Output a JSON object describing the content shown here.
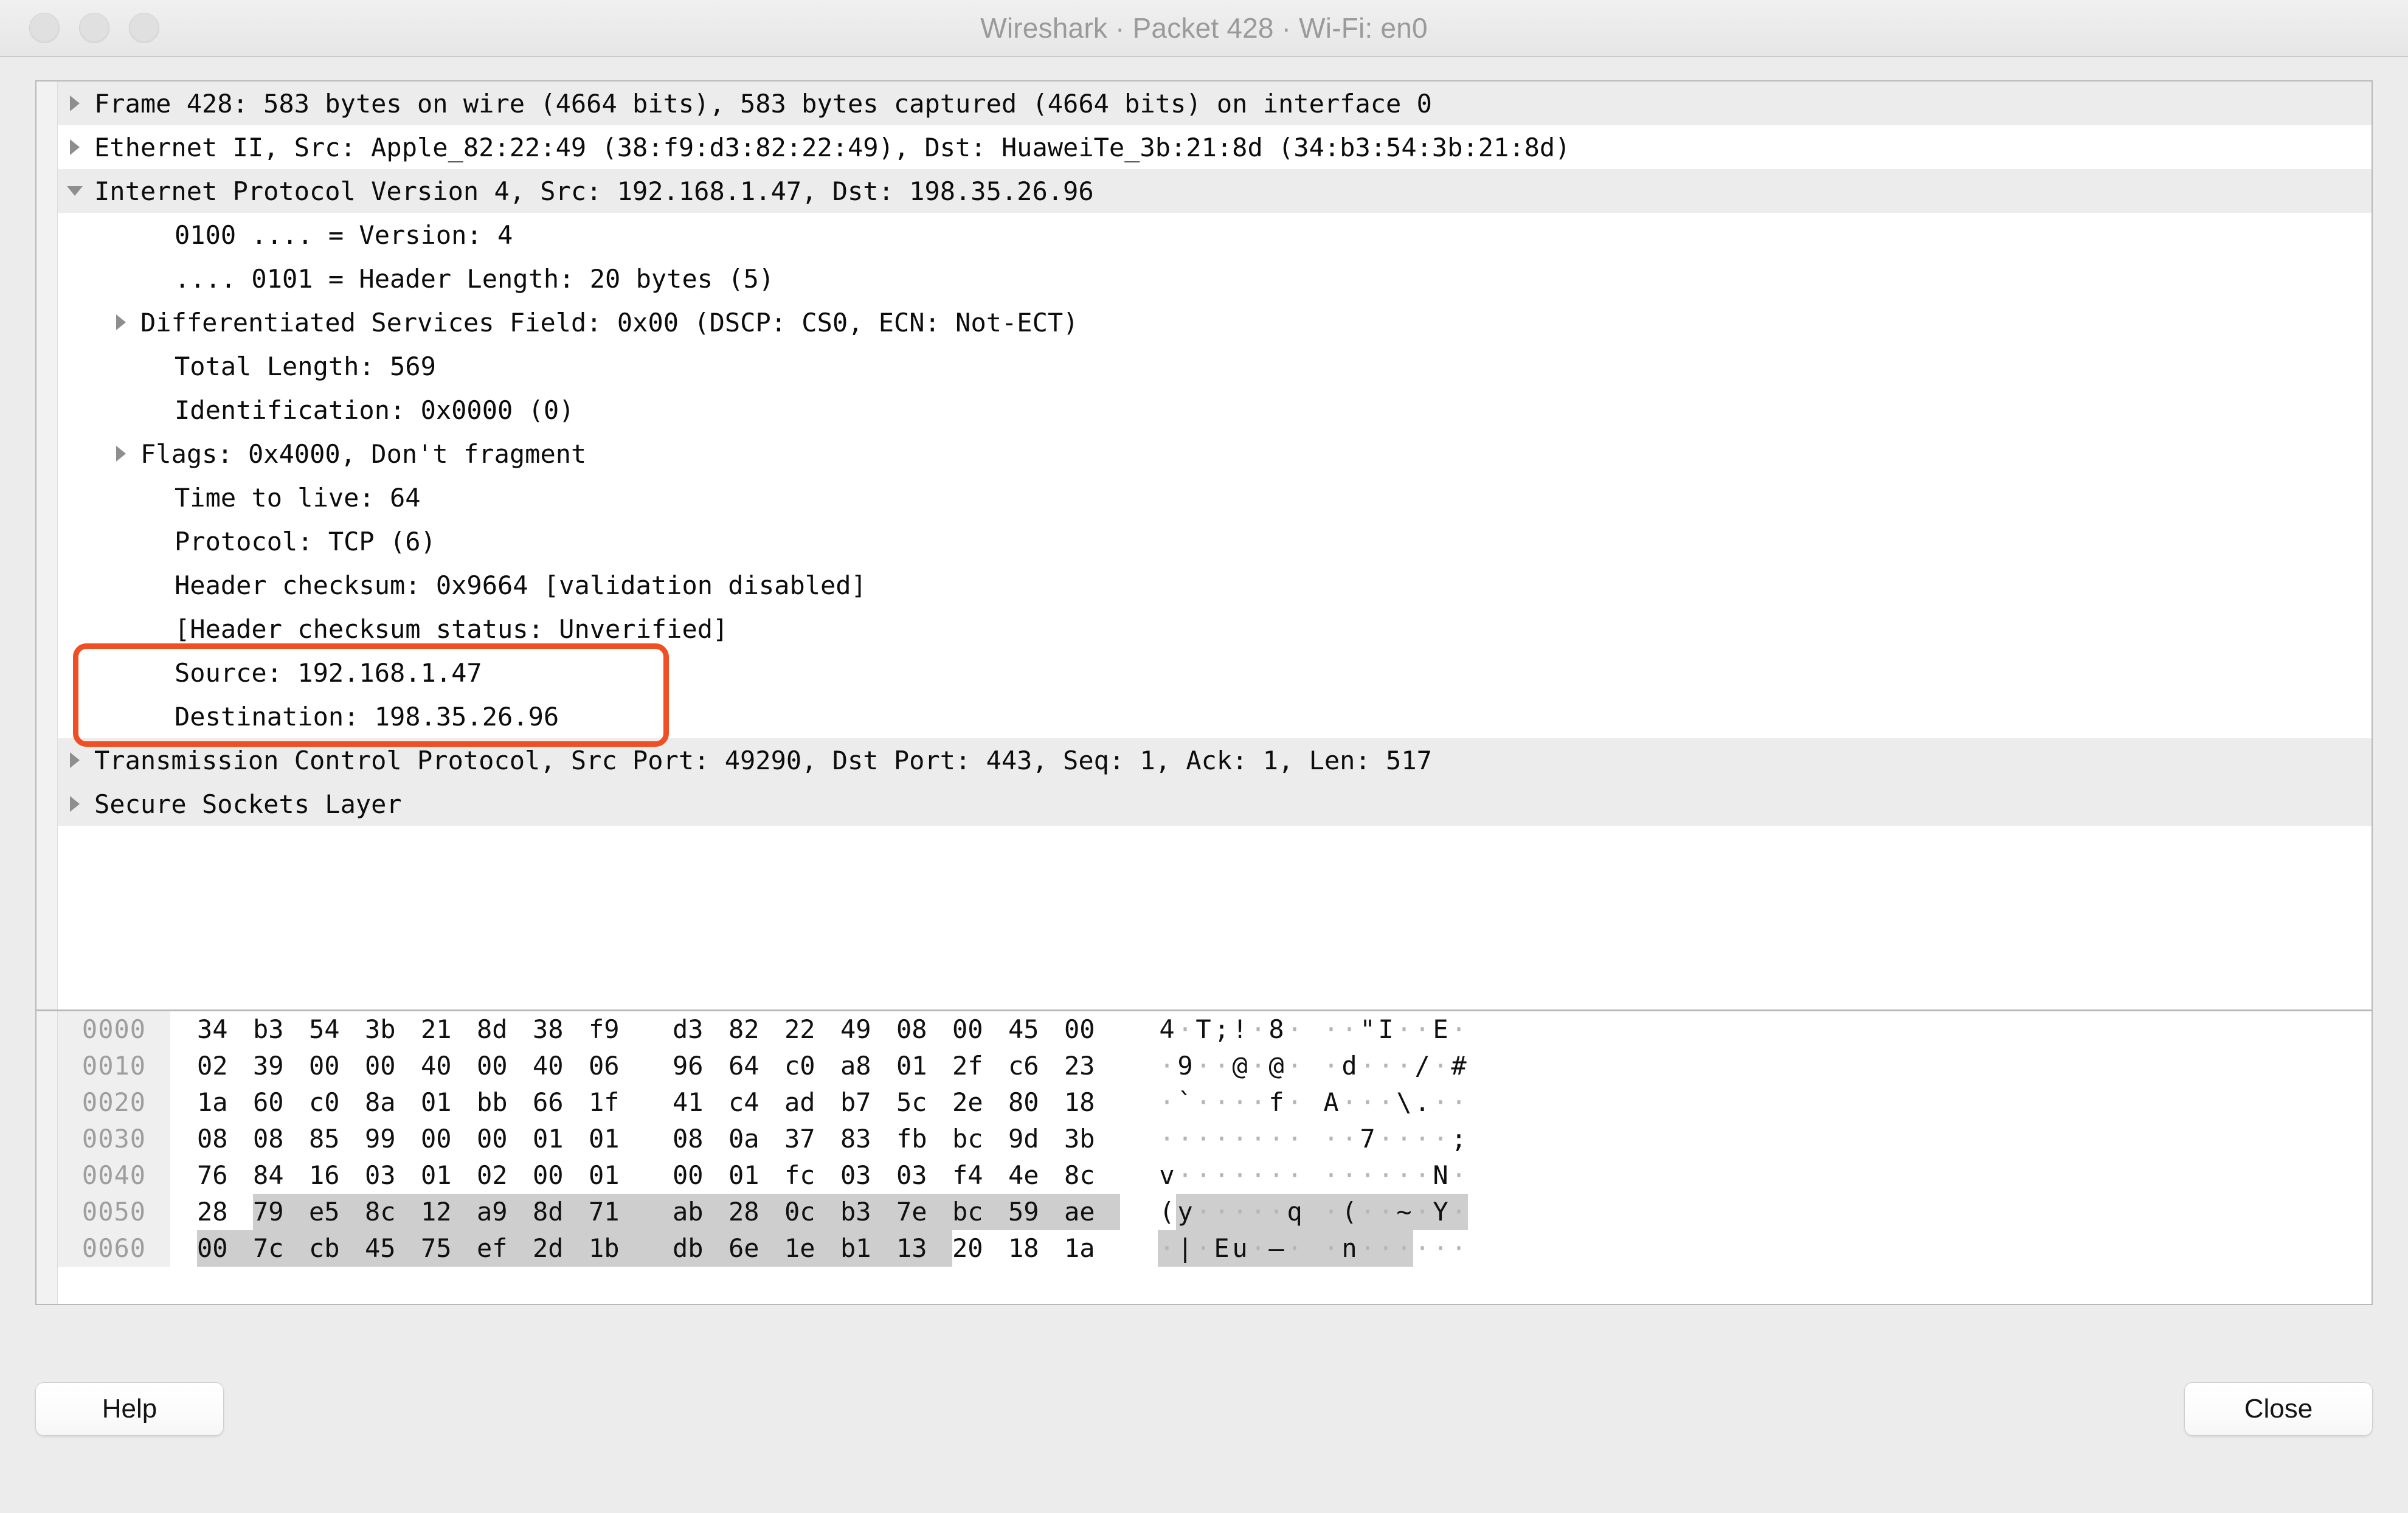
{
  "window": {
    "title": "Wireshark · Packet 428 · Wi-Fi: en0",
    "traffic_lights": [
      "close",
      "minimize",
      "zoom"
    ]
  },
  "accent_color": "#f04e23",
  "detail_tree": [
    {
      "depth": 0,
      "twisty": "collapsed",
      "shaded": true,
      "text": "Frame 428: 583 bytes on wire (4664 bits), 583 bytes captured (4664 bits) on interface 0"
    },
    {
      "depth": 0,
      "twisty": "collapsed",
      "shaded": false,
      "text": "Ethernet II, Src: Apple_82:22:49 (38:f9:d3:82:22:49), Dst: HuaweiTe_3b:21:8d (34:b3:54:3b:21:8d)"
    },
    {
      "depth": 0,
      "twisty": "expanded",
      "shaded": true,
      "text": "Internet Protocol Version 4, Src: 192.168.1.47, Dst: 198.35.26.96"
    },
    {
      "depth": 1,
      "twisty": "none",
      "shaded": false,
      "text": "0100 .... = Version: 4"
    },
    {
      "depth": 1,
      "twisty": "none",
      "shaded": false,
      "text": ".... 0101 = Header Length: 20 bytes (5)"
    },
    {
      "depth": 1,
      "twisty": "collapsed",
      "shaded": false,
      "text": "Differentiated Services Field: 0x00 (DSCP: CS0, ECN: Not-ECT)"
    },
    {
      "depth": 1,
      "twisty": "none",
      "shaded": false,
      "text": "Total Length: 569"
    },
    {
      "depth": 1,
      "twisty": "none",
      "shaded": false,
      "text": "Identification: 0x0000 (0)"
    },
    {
      "depth": 1,
      "twisty": "collapsed",
      "shaded": false,
      "text": "Flags: 0x4000, Don't fragment"
    },
    {
      "depth": 1,
      "twisty": "none",
      "shaded": false,
      "text": "Time to live: 64"
    },
    {
      "depth": 1,
      "twisty": "none",
      "shaded": false,
      "text": "Protocol: TCP (6)"
    },
    {
      "depth": 1,
      "twisty": "none",
      "shaded": false,
      "text": "Header checksum: 0x9664 [validation disabled]"
    },
    {
      "depth": 1,
      "twisty": "none",
      "shaded": false,
      "text": "[Header checksum status: Unverified]"
    },
    {
      "depth": 1,
      "twisty": "none",
      "shaded": false,
      "text": "Source: 192.168.1.47"
    },
    {
      "depth": 1,
      "twisty": "none",
      "shaded": false,
      "text": "Destination: 198.35.26.96"
    },
    {
      "depth": 0,
      "twisty": "collapsed",
      "shaded": true,
      "text": "Transmission Control Protocol, Src Port: 49290, Dst Port: 443, Seq: 1, Ack: 1, Len: 517"
    },
    {
      "depth": 0,
      "twisty": "collapsed",
      "shaded": true,
      "text": "Secure Sockets Layer"
    }
  ],
  "annotation": {
    "label": "source-destination-highlight",
    "color": "#f04e23",
    "covers": [
      "Source: 192.168.1.47",
      "Destination: 198.35.26.96"
    ]
  },
  "hex_dump": [
    {
      "offset": "0000",
      "bytes": [
        "34",
        "b3",
        "54",
        "3b",
        "21",
        "8d",
        "38",
        "f9",
        "d3",
        "82",
        "22",
        "49",
        "08",
        "00",
        "45",
        "00"
      ],
      "ascii": [
        "4",
        ".",
        "T",
        ";",
        "!",
        ".",
        "8",
        ".",
        ".",
        ".",
        "\"",
        "I",
        ".",
        ".",
        "E",
        "."
      ],
      "printable": [
        true,
        false,
        true,
        true,
        true,
        false,
        true,
        false,
        false,
        false,
        true,
        true,
        false,
        false,
        true,
        false
      ],
      "selected": []
    },
    {
      "offset": "0010",
      "bytes": [
        "02",
        "39",
        "00",
        "00",
        "40",
        "00",
        "40",
        "06",
        "96",
        "64",
        "c0",
        "a8",
        "01",
        "2f",
        "c6",
        "23"
      ],
      "ascii": [
        ".",
        "9",
        ".",
        ".",
        "@",
        ".",
        "@",
        ".",
        ".",
        "d",
        ".",
        ".",
        ".",
        "/",
        ".",
        "#"
      ],
      "printable": [
        false,
        true,
        false,
        false,
        true,
        false,
        true,
        false,
        false,
        true,
        false,
        false,
        false,
        true,
        false,
        true
      ],
      "selected": []
    },
    {
      "offset": "0020",
      "bytes": [
        "1a",
        "60",
        "c0",
        "8a",
        "01",
        "bb",
        "66",
        "1f",
        "41",
        "c4",
        "ad",
        "b7",
        "5c",
        "2e",
        "80",
        "18"
      ],
      "ascii": [
        ".",
        "`",
        ".",
        ".",
        ".",
        ".",
        "f",
        ".",
        "A",
        ".",
        ".",
        ".",
        "\\",
        ".",
        ".",
        "."
      ],
      "printable": [
        false,
        true,
        false,
        false,
        false,
        false,
        true,
        false,
        true,
        false,
        false,
        false,
        true,
        true,
        false,
        false
      ],
      "selected": []
    },
    {
      "offset": "0030",
      "bytes": [
        "08",
        "08",
        "85",
        "99",
        "00",
        "00",
        "01",
        "01",
        "08",
        "0a",
        "37",
        "83",
        "fb",
        "bc",
        "9d",
        "3b"
      ],
      "ascii": [
        ".",
        ".",
        ".",
        ".",
        ".",
        ".",
        ".",
        ".",
        ".",
        ".",
        "7",
        ".",
        ".",
        ".",
        ".",
        ";"
      ],
      "printable": [
        false,
        false,
        false,
        false,
        false,
        false,
        false,
        false,
        false,
        false,
        true,
        false,
        false,
        false,
        false,
        true
      ],
      "selected": []
    },
    {
      "offset": "0040",
      "bytes": [
        "76",
        "84",
        "16",
        "03",
        "01",
        "02",
        "00",
        "01",
        "00",
        "01",
        "fc",
        "03",
        "03",
        "f4",
        "4e",
        "8c"
      ],
      "ascii": [
        "v",
        ".",
        ".",
        ".",
        ".",
        ".",
        ".",
        ".",
        ".",
        ".",
        ".",
        ".",
        ".",
        ".",
        "N",
        "."
      ],
      "printable": [
        true,
        false,
        false,
        false,
        false,
        false,
        false,
        false,
        false,
        false,
        false,
        false,
        false,
        false,
        true,
        false
      ],
      "selected": []
    },
    {
      "offset": "0050",
      "bytes": [
        "28",
        "79",
        "e5",
        "8c",
        "12",
        "a9",
        "8d",
        "71",
        "ab",
        "28",
        "0c",
        "b3",
        "7e",
        "bc",
        "59",
        "ae"
      ],
      "ascii": [
        "(",
        "y",
        ".",
        ".",
        ".",
        ".",
        ".",
        "q",
        ".",
        "(",
        ".",
        ".",
        "~",
        ".",
        "Y",
        "."
      ],
      "printable": [
        true,
        true,
        false,
        false,
        false,
        false,
        false,
        true,
        false,
        true,
        false,
        false,
        true,
        false,
        true,
        false
      ],
      "selected": [
        1,
        2,
        3,
        4,
        5,
        6,
        7,
        8,
        9,
        10,
        11,
        12,
        13,
        14,
        15
      ]
    },
    {
      "offset": "0060",
      "bytes": [
        "00",
        "7c",
        "cb",
        "45",
        "75",
        "ef",
        "2d",
        "1b",
        "db",
        "6e",
        "1e",
        "b1",
        "13",
        "20",
        "18",
        "1a"
      ],
      "ascii": [
        ".",
        "|",
        ".",
        "E",
        "u",
        ".",
        "—",
        ".",
        ".",
        "n",
        ".",
        ".",
        ".",
        ".",
        ".",
        "."
      ],
      "printable": [
        false,
        true,
        false,
        true,
        true,
        false,
        true,
        false,
        false,
        true,
        false,
        false,
        false,
        false,
        false,
        false
      ],
      "selected": [
        0,
        1,
        2,
        3,
        4,
        5,
        6,
        7,
        8,
        9,
        10,
        11,
        12
      ]
    }
  ],
  "footer": {
    "help_label": "Help",
    "close_label": "Close"
  }
}
